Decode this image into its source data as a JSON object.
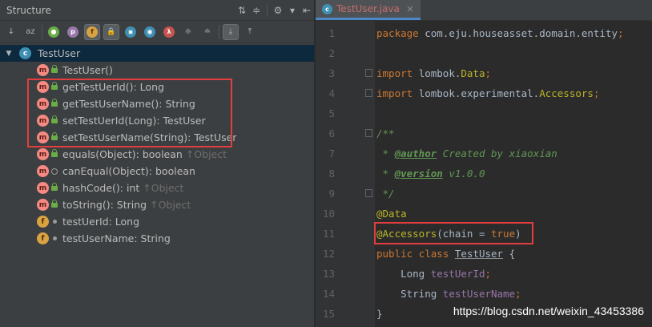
{
  "structure_panel": {
    "title": "Structure",
    "header_buttons": [
      "⇅",
      "≑",
      "⚙",
      "▾",
      "⇤"
    ],
    "toolbar": [
      {
        "icon": "sort-visibility-icon",
        "glyph": "↓",
        "active": false
      },
      {
        "icon": "sort-alpha-icon",
        "glyph": "az",
        "active": false
      },
      {
        "icon": "show-properties-icon",
        "glyph": "●",
        "active": false
      },
      {
        "icon": "show-properties-p-icon",
        "glyph": "p",
        "active": false
      },
      {
        "icon": "show-fields-icon",
        "glyph": "f",
        "active": true
      },
      {
        "icon": "show-non-public-icon",
        "glyph": "🔒",
        "active": true
      },
      {
        "icon": "show-lambdas-icon",
        "glyph": "⧆",
        "active": false
      },
      {
        "icon": "show-anonymous-icon",
        "glyph": "◉",
        "active": false
      },
      {
        "icon": "show-lambda-icon",
        "glyph": "λ",
        "active": false
      },
      {
        "icon": "expand-all-icon",
        "glyph": "≑",
        "active": false
      },
      {
        "icon": "collapse-all-icon",
        "glyph": "≐",
        "active": false
      },
      {
        "icon": "autoscroll-to-source-icon",
        "glyph": "⤓",
        "active": true
      },
      {
        "icon": "autoscroll-from-source-icon",
        "glyph": "⤒",
        "active": false
      }
    ],
    "root": {
      "label": "TestUser",
      "icon": "c"
    },
    "items": [
      {
        "label": "TestUser()",
        "icon": "m",
        "vis": "lock",
        "inherited": ""
      },
      {
        "label": "getTestUerId(): Long",
        "icon": "m",
        "vis": "lock",
        "inherited": ""
      },
      {
        "label": "getTestUserName(): String",
        "icon": "m",
        "vis": "lock",
        "inherited": ""
      },
      {
        "label": "setTestUerId(Long): TestUser",
        "icon": "m",
        "vis": "lock",
        "inherited": ""
      },
      {
        "label": "setTestUserName(String): TestUser",
        "icon": "m",
        "vis": "lock",
        "inherited": ""
      },
      {
        "label": "equals(Object): boolean",
        "icon": "m",
        "vis": "lock",
        "inherited": "↑Object"
      },
      {
        "label": "canEqual(Object): boolean",
        "icon": "m",
        "vis": "key",
        "inherited": ""
      },
      {
        "label": "hashCode(): int",
        "icon": "m",
        "vis": "lock",
        "inherited": "↑Object"
      },
      {
        "label": "toString(): String",
        "icon": "m",
        "vis": "lock",
        "inherited": "↑Object"
      },
      {
        "label": "testUerId: Long",
        "icon": "f",
        "vis": "dot",
        "inherited": ""
      },
      {
        "label": "testUserName: String",
        "icon": "f",
        "vis": "dot",
        "inherited": ""
      }
    ]
  },
  "editor": {
    "tab": {
      "label": "TestUser.java",
      "icon": "c",
      "close": "×"
    },
    "lines": [
      {
        "n": "1",
        "fold": false,
        "segs": [
          [
            "kw",
            "package "
          ],
          [
            "t",
            "com.eju.houseasset.domain.entity"
          ],
          [
            "kw",
            ";"
          ]
        ]
      },
      {
        "n": "2",
        "fold": false,
        "segs": []
      },
      {
        "n": "3",
        "fold": true,
        "segs": [
          [
            "kw",
            "import "
          ],
          [
            "t",
            "lombok."
          ],
          [
            "ann",
            "Data"
          ],
          [
            "kw",
            ";"
          ]
        ]
      },
      {
        "n": "4",
        "fold": true,
        "segs": [
          [
            "kw",
            "import "
          ],
          [
            "t",
            "lombok.experimental."
          ],
          [
            "ann",
            "Accessors"
          ],
          [
            "kw",
            ";"
          ]
        ]
      },
      {
        "n": "5",
        "fold": false,
        "segs": []
      },
      {
        "n": "6",
        "fold": true,
        "segs": [
          [
            "doc",
            "/**"
          ]
        ]
      },
      {
        "n": "7",
        "fold": false,
        "segs": [
          [
            "doc",
            " * "
          ],
          [
            "tag",
            "@author"
          ],
          [
            "doc",
            " Created by xiaoxian"
          ]
        ]
      },
      {
        "n": "8",
        "fold": false,
        "segs": [
          [
            "doc",
            " * "
          ],
          [
            "tag",
            "@version"
          ],
          [
            "doc",
            " v1.0.0"
          ]
        ]
      },
      {
        "n": "9",
        "fold": true,
        "segs": [
          [
            "doc",
            " */"
          ]
        ]
      },
      {
        "n": "10",
        "fold": false,
        "segs": [
          [
            "ann",
            "@Data"
          ]
        ]
      },
      {
        "n": "11",
        "fold": false,
        "segs": [
          [
            "ann",
            "@Accessors"
          ],
          [
            "t",
            "(chain = "
          ],
          [
            "kw",
            "true"
          ],
          [
            "t",
            ")"
          ]
        ]
      },
      {
        "n": "12",
        "fold": false,
        "segs": [
          [
            "kw",
            "public class "
          ],
          [
            "und",
            "TestUser"
          ],
          [
            "t",
            " {"
          ]
        ]
      },
      {
        "n": "13",
        "fold": false,
        "segs": [
          [
            "t",
            "    Long "
          ],
          [
            "fld",
            "testUerId"
          ],
          [
            "kw",
            ";"
          ]
        ]
      },
      {
        "n": "14",
        "fold": false,
        "segs": [
          [
            "t",
            "    String "
          ],
          [
            "fld",
            "testUserName"
          ],
          [
            "kw",
            ";"
          ]
        ]
      },
      {
        "n": "15",
        "fold": false,
        "segs": [
          [
            "t",
            "}"
          ]
        ]
      }
    ]
  },
  "watermark": "https://blog.csdn.net/weixin_43453386",
  "colors": {
    "highlight_box": "#e33e3e",
    "keyword": "#cc7832",
    "annotation": "#bbb529",
    "doc": "#629755",
    "field": "#9876aa"
  }
}
